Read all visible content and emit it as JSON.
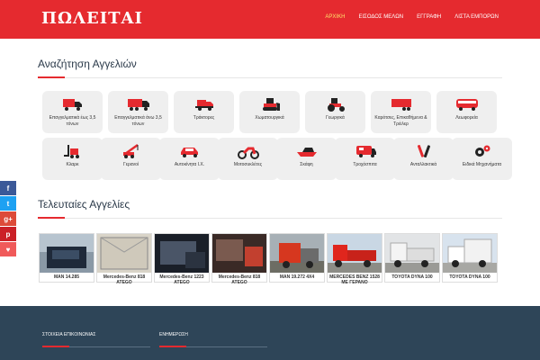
{
  "brand": {
    "logo": "ΠΩΛΕΙΤΑΙ",
    "accent": "#e52a2f",
    "dark": "#2e4558"
  },
  "nav": [
    {
      "label": "ΑΡΧΙΚΗ",
      "active": true
    },
    {
      "label": "ΕΙΣΟΔΟΣ ΜΕΛΩΝ"
    },
    {
      "label": "ΕΓΓΡΑΦΗ"
    },
    {
      "label": "ΛΙΣΤΑ ΕΜΠΟΡΩΝ"
    }
  ],
  "search": {
    "title": "Αναζήτηση Αγγελιών"
  },
  "categories": [
    {
      "label": "Επαγγελματικά έως 3,5 τόνων",
      "icon": "truck-small-icon"
    },
    {
      "label": "Επαγγελματικά άνω 3,5 τόνων",
      "icon": "truck-large-icon"
    },
    {
      "label": "Τράκτορες",
      "icon": "tractor-truck-icon"
    },
    {
      "label": "Χωματουργικά",
      "icon": "bulldozer-icon"
    },
    {
      "label": "Γεωργικά",
      "icon": "farm-tractor-icon"
    },
    {
      "label": "Καρότσες, Επικαθήμενα & Τρέιλερ",
      "icon": "trailer-icon"
    },
    {
      "label": "Λεωφορεία",
      "icon": "bus-icon"
    },
    {
      "label": "Κλαρκ",
      "icon": "forklift-icon"
    },
    {
      "label": "Γερανοί",
      "icon": "crane-icon"
    },
    {
      "label": "Αυτοκίνητα Ι.Χ.",
      "icon": "car-icon"
    },
    {
      "label": "Μοτοσυκλέτες",
      "icon": "motorcycle-icon"
    },
    {
      "label": "Σκάφη",
      "icon": "boat-icon"
    },
    {
      "label": "Τροχόσπιτα",
      "icon": "caravan-icon"
    },
    {
      "label": "Ανταλλακτικά",
      "icon": "tools-icon"
    },
    {
      "label": "Ειδικά Μηχανήματα",
      "icon": "gears-icon"
    }
  ],
  "latest": {
    "title": "Τελευταίες Αγγελίες",
    "items": [
      {
        "name": "MAN 14.285"
      },
      {
        "name": "Mercedes-Benz 818 ATEGO"
      },
      {
        "name": "Mercedes-Benz 1223 ATEGO"
      },
      {
        "name": "Mercedes-Benz 818 ATEGO"
      },
      {
        "name": "MAN 19.272 4X4"
      },
      {
        "name": "MERCEDES BENZ 1528 ΜΕ ΓΕΡΑΝΟ"
      },
      {
        "name": "TOYOTA DYNA 100"
      },
      {
        "name": "TOYOTA DYNA 100"
      }
    ]
  },
  "social": [
    {
      "icon": "facebook-icon",
      "glyph": "f",
      "color": "#3b5998"
    },
    {
      "icon": "twitter-icon",
      "glyph": "t",
      "color": "#1da1f2"
    },
    {
      "icon": "google-plus-icon",
      "glyph": "g+",
      "color": "#dd4b39"
    },
    {
      "icon": "pinterest-icon",
      "glyph": "p",
      "color": "#cb2027"
    },
    {
      "icon": "heart-icon",
      "glyph": "♥",
      "color": "#f05a5a"
    }
  ],
  "footer": {
    "contact": "ΣΤΟΙΧΕΙΑ ΕΠΙΚΟΙΝΩΝΙΑΣ",
    "news": "ΕΝΗΜΕΡΩΣΗ"
  }
}
